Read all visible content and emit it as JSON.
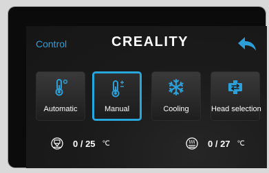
{
  "header": {
    "control_label": "Control",
    "logo_text": "CREALITY",
    "back_icon": "back-arrow-icon"
  },
  "modes": [
    {
      "label": "Automatic",
      "icon": "thermometer-degree-icon",
      "active": false
    },
    {
      "label": "Manual",
      "icon": "thermometer-plus-minus-icon",
      "active": true
    },
    {
      "label": "Cooling",
      "icon": "snowflake-icon",
      "active": false
    },
    {
      "label": "Head selection",
      "icon": "extruder-switch-icon",
      "active": false
    }
  ],
  "temps": {
    "nozzle": {
      "icon": "nozzle-icon",
      "current": "0",
      "target": "25",
      "unit": "℃"
    },
    "bed": {
      "icon": "heated-bed-icon",
      "current": "0",
      "target": "27",
      "unit": "℃"
    }
  },
  "colors": {
    "accent": "#27a7dc",
    "label_blue": "#2d9fd8",
    "background": "#1b1b1b"
  }
}
